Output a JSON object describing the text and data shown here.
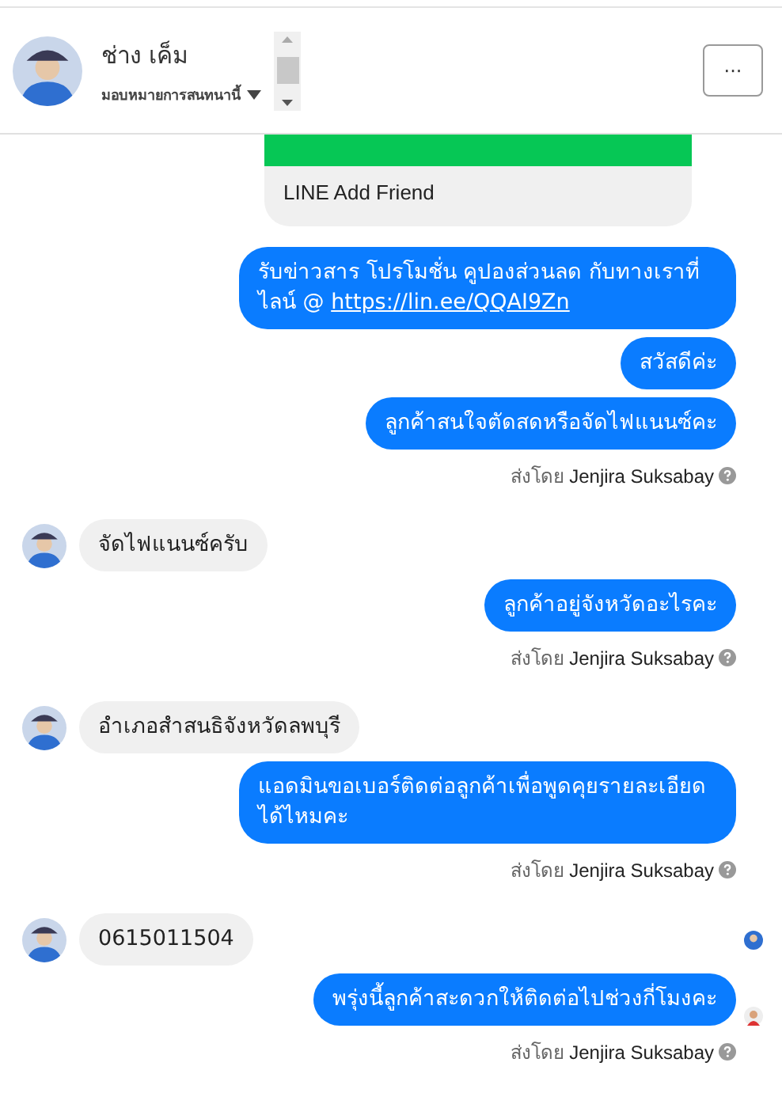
{
  "header": {
    "name": "ช่าง เค็ม",
    "assign_label": "มอบหมายการสนทนานี้",
    "more_button": "···"
  },
  "messages": [
    {
      "kind": "card",
      "label": "LINE Add Friend"
    },
    {
      "kind": "out",
      "text": "รับข่าวสาร  โปรโมชั่น คูปองส่วนลด กับทางเราที่ไลน์ @ ",
      "link": "https://lin.ee/QQAI9Zn"
    },
    {
      "kind": "out",
      "text": "สวัสดีค่ะ"
    },
    {
      "kind": "out",
      "text": "ลูกค้าสนใจตัดสดหรือจัดไฟแนนซ์คะ"
    },
    {
      "kind": "meta",
      "label": "ส่งโดย",
      "name": "Jenjira Suksabay"
    },
    {
      "kind": "in",
      "text": "จัดไฟแนนซ์ครับ"
    },
    {
      "kind": "out",
      "text": "ลูกค้าอยู่จังหวัดอะไรคะ"
    },
    {
      "kind": "meta",
      "label": "ส่งโดย",
      "name": "Jenjira Suksabay"
    },
    {
      "kind": "in",
      "text": "อำเภอสำสนธิจังหวัดลพบุรี"
    },
    {
      "kind": "out",
      "text": "แอดมินขอเบอร์ติดต่อลูกค้าเพื่อพูดคุยรายละเอียดได้ไหมคะ"
    },
    {
      "kind": "meta",
      "label": "ส่งโดย",
      "name": "Jenjira Suksabay"
    },
    {
      "kind": "in",
      "text": "0615011504",
      "seen": true
    },
    {
      "kind": "out",
      "text": "พรุ่งนี้ลูกค้าสะดวกให้ติดต่อไปช่วงกี่โมงคะ",
      "seen": true
    },
    {
      "kind": "meta",
      "label": "ส่งโดย",
      "name": "Jenjira Suksabay"
    }
  ]
}
